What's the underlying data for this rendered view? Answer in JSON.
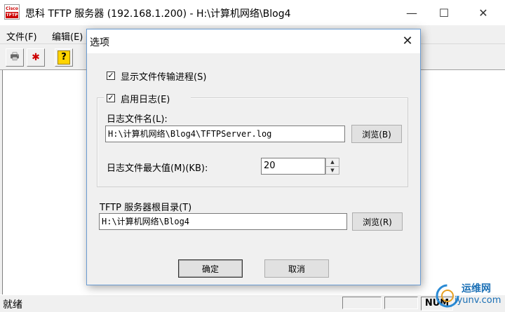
{
  "window": {
    "title": "思科 TFTP 服务器 (192.168.1.200) - H:\\计算机网络\\Blog4",
    "icon_top": "Cisco",
    "icon_bottom": "TFTP",
    "minimize_glyph": "—",
    "maximize_glyph": "☐",
    "close_glyph": "✕"
  },
  "menubar": {
    "items": [
      "文件(F)",
      "编辑(E)"
    ]
  },
  "toolbar": {
    "buttons": [
      {
        "icon": "printer-icon",
        "glyph": "🖶"
      },
      {
        "icon": "options-icon",
        "glyph": "✱"
      },
      {
        "icon": "help-icon",
        "glyph": "?"
      }
    ]
  },
  "statusbar": {
    "text": "就绪",
    "num": "NUM"
  },
  "watermark": {
    "name": "运维网",
    "url": "iyunv.com"
  },
  "dialog": {
    "title": "选项",
    "close_glyph": "✕",
    "show_progress": {
      "label": "显示文件传输进程(S)",
      "checked": true
    },
    "enable_log": {
      "label": "启用日志(E)",
      "checked": true
    },
    "log_file_label": "日志文件名(L):",
    "log_file_value": "H:\\计算机网络\\Blog4\\TFTPServer.log",
    "browse_b_label": "浏览(B)",
    "log_max_label": "日志文件最大值(M)(KB):",
    "log_max_value": "20",
    "root_dir_label": "TFTP 服务器根目录(T)",
    "root_dir_value": "H:\\计算机网络\\Blog4",
    "browse_r_label": "浏览(R)",
    "ok_label": "确定",
    "cancel_label": "取消"
  }
}
